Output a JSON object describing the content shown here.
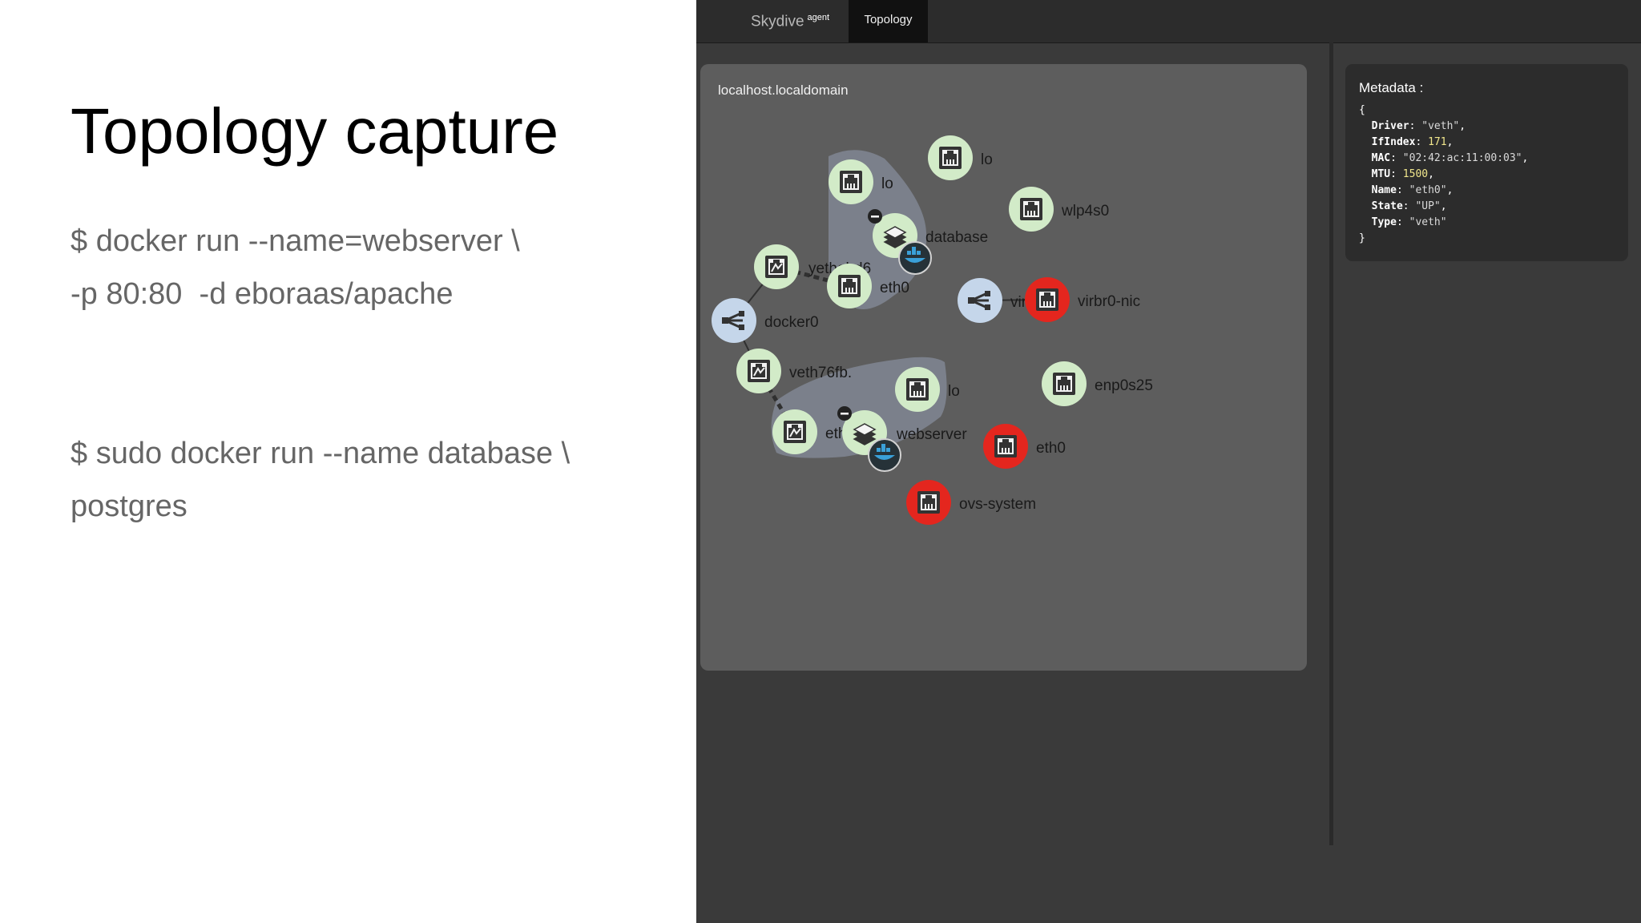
{
  "slide": {
    "title": "Topology capture",
    "command1_line1": "$ docker run --name=webserver \\",
    "command1_line2": "-p 80:80  -d eboraas/apache",
    "command2_line1": "$ sudo docker run --name database \\",
    "command2_line2": "postgres"
  },
  "navbar": {
    "brand": "Skydive",
    "brand_sup": "agent",
    "active_tab": "Topology"
  },
  "topology": {
    "host_label": "localhost.localdomain",
    "nodes": [
      {
        "id": "lo-host",
        "label": "lo",
        "kind": "interface",
        "state": "up"
      },
      {
        "id": "wlp4s0",
        "label": "wlp4s0",
        "kind": "interface",
        "state": "up"
      },
      {
        "id": "lo-db",
        "label": "lo",
        "kind": "interface",
        "state": "up"
      },
      {
        "id": "database",
        "label": "database",
        "kind": "netns-container",
        "state": "up"
      },
      {
        "id": "yethabd6",
        "label": "yethabd6",
        "kind": "veth",
        "state": "up"
      },
      {
        "id": "eth0-db",
        "label": "eth0",
        "kind": "interface",
        "state": "up"
      },
      {
        "id": "docker0",
        "label": "docker0",
        "kind": "bridge",
        "state": "bridge"
      },
      {
        "id": "virbr0",
        "label": "virbr0",
        "kind": "bridge",
        "state": "bridge"
      },
      {
        "id": "virbr0-nic",
        "label": "virbr0-nic",
        "kind": "interface",
        "state": "down"
      },
      {
        "id": "veth76fb",
        "label": "veth76fb.",
        "kind": "veth",
        "state": "up"
      },
      {
        "id": "lo-web",
        "label": "lo",
        "kind": "interface",
        "state": "up"
      },
      {
        "id": "enp0s25",
        "label": "enp0s25",
        "kind": "interface",
        "state": "up"
      },
      {
        "id": "eth0-web",
        "label": "eth0",
        "kind": "veth",
        "state": "up"
      },
      {
        "id": "webserver",
        "label": "webserver",
        "kind": "netns-container",
        "state": "up"
      },
      {
        "id": "eth0-host",
        "label": "eth0",
        "kind": "interface",
        "state": "down"
      },
      {
        "id": "ovs-system",
        "label": "ovs-system",
        "kind": "interface",
        "state": "down"
      }
    ],
    "colors": {
      "panel": "#5d5d5d",
      "group": "#7b808b",
      "node_up": "#d2ebc8",
      "node_down": "#e4261e",
      "node_bridge": "#c5d6ea",
      "icon": "#333333",
      "docker_badge": "#263238",
      "docker_whale": "#3aa0d8"
    }
  },
  "metadata": {
    "title": "Metadata :",
    "open_brace": "{",
    "close_brace": "}",
    "fields": [
      {
        "key": "Driver",
        "value": "\"veth\"",
        "type": "string"
      },
      {
        "key": "IfIndex",
        "value": "171",
        "type": "number"
      },
      {
        "key": "MAC",
        "value": "\"02:42:ac:11:00:03\"",
        "type": "string"
      },
      {
        "key": "MTU",
        "value": "1500",
        "type": "number"
      },
      {
        "key": "Name",
        "value": "\"eth0\"",
        "type": "string"
      },
      {
        "key": "State",
        "value": "\"UP\"",
        "type": "string"
      },
      {
        "key": "Type",
        "value": "\"veth\"",
        "type": "string"
      }
    ]
  }
}
